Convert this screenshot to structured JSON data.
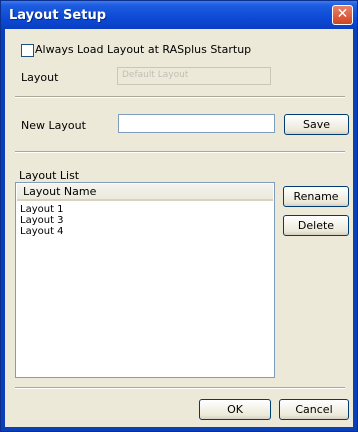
{
  "window": {
    "title": "Layout Setup",
    "close_glyph": "✕"
  },
  "options": {
    "always_load_label": "Always Load Layout at RASplus Startup",
    "always_load_checked": false
  },
  "layout_field": {
    "label": "Layout",
    "value": "Default Layout"
  },
  "new_layout": {
    "label": "New Layout",
    "value": "",
    "save_label": "Save"
  },
  "layout_list": {
    "section_label": "Layout List",
    "column_header": "Layout Name",
    "items": [
      "Layout 1",
      "Layout 3",
      "Layout 4"
    ],
    "rename_label": "Rename",
    "delete_label": "Delete"
  },
  "footer": {
    "ok_label": "OK",
    "cancel_label": "Cancel"
  }
}
